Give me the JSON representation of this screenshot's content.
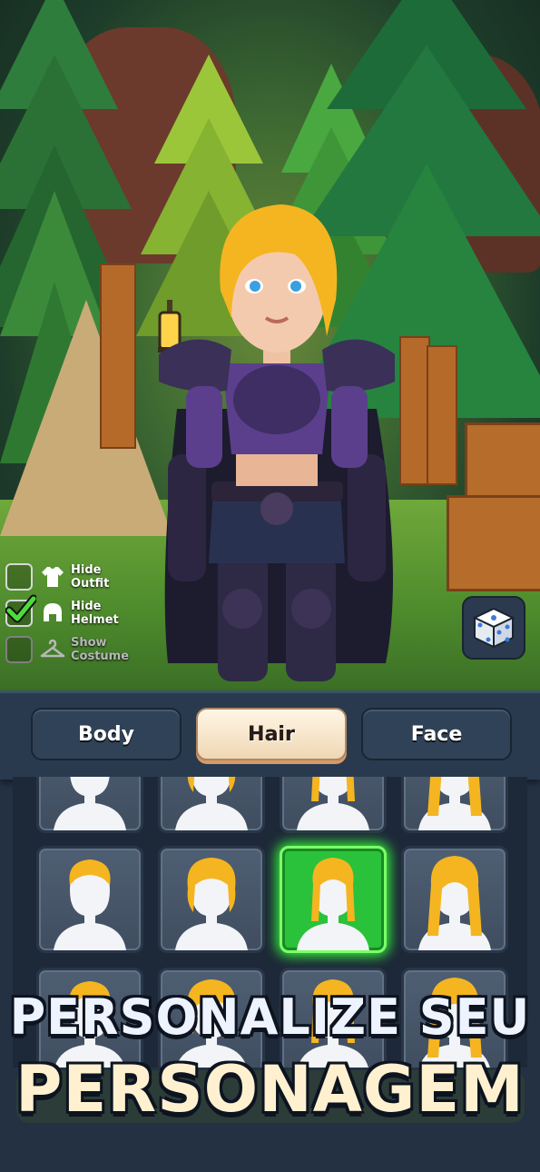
{
  "toggles": [
    {
      "label": "Hide\nOutfit",
      "checked": false,
      "icon": "shirt-icon"
    },
    {
      "label": "Hide\nHelmet",
      "checked": true,
      "icon": "helmet-icon"
    },
    {
      "label": "Show\nCostume",
      "checked": false,
      "icon": "hanger-icon",
      "disabled": true
    }
  ],
  "tabs": [
    {
      "label": "Body",
      "active": false
    },
    {
      "label": "Hair",
      "active": true
    },
    {
      "label": "Face",
      "active": false
    }
  ],
  "randomize": {
    "icon": "dice-icon"
  },
  "hair_grid": {
    "selected_index": 6,
    "styles": [
      "hair-ponytail",
      "hair-short-wavy",
      "hair-braids",
      "hair-long-braids",
      "hair-curly-long",
      "hair-wavy-braid",
      "hair-bob",
      "hair-bangs-long",
      "hair-1",
      "hair-2",
      "hair-3",
      "hair-4"
    ]
  },
  "colors": {
    "hair": "#f5b520",
    "selected": "#35ff3a",
    "tab_active": "#f7e4c8"
  },
  "headline": {
    "line1": "PERSONALIZE SEU",
    "line2": "PERSONAGEM"
  }
}
